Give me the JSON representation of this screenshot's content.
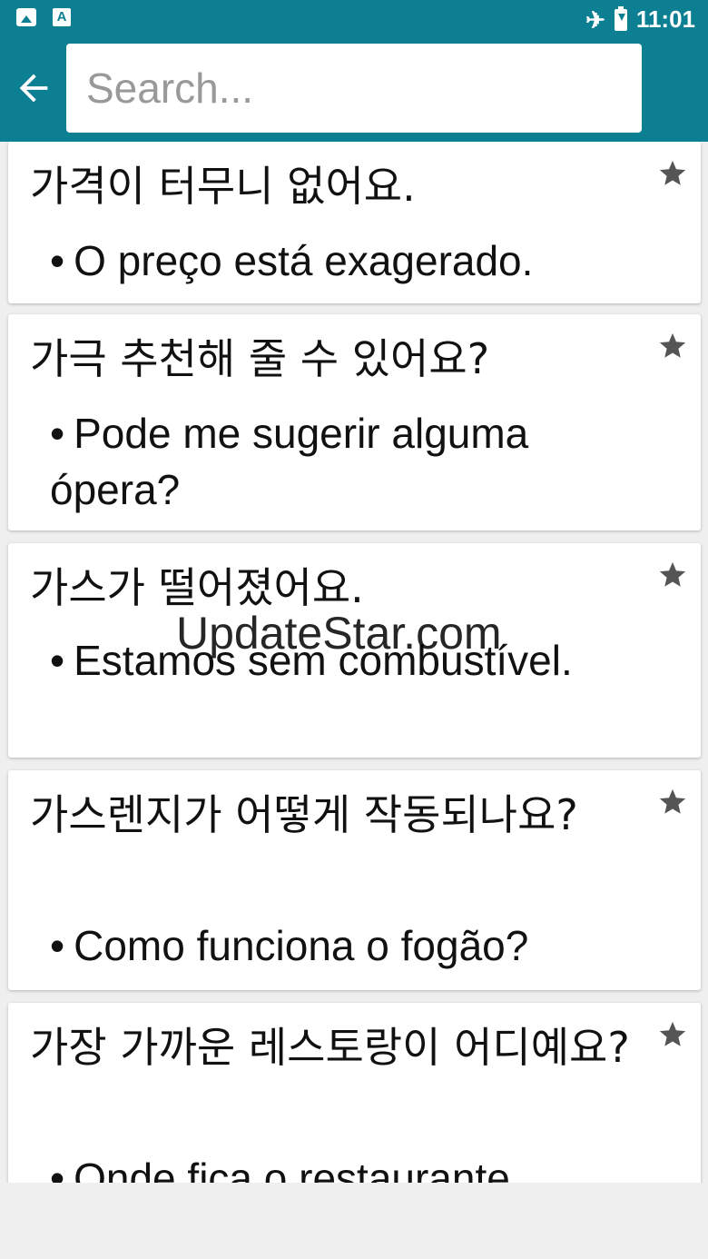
{
  "status_bar": {
    "time": "11:01",
    "left_icons": [
      "image-icon",
      "text-a-icon"
    ],
    "right_icons": [
      "airplane-mode-icon",
      "battery-charging-icon"
    ]
  },
  "app_bar": {
    "back_icon": "arrow-left-icon",
    "search": {
      "placeholder": "Search...",
      "value": ""
    },
    "colors": {
      "primary": "#0c7f92",
      "background": "#efefef"
    }
  },
  "phrases": [
    {
      "korean": "가격이 터무니 없어요.",
      "translation": "O preço está exagerado.",
      "star_icon": "star-icon"
    },
    {
      "korean": "가극 추천해 줄 수 있어요?",
      "translation": "Pode me sugerir alguma ópera?",
      "star_icon": "star-icon"
    },
    {
      "korean": "가스가 떨어졌어요.",
      "translation": "Estamos sem combustível.",
      "star_icon": "star-icon"
    },
    {
      "korean": "가스렌지가 어떻게 작동되나요?",
      "translation": "Como funciona o fogão?",
      "star_icon": "star-icon"
    },
    {
      "korean": "가장 가까운 레스토랑이 어디예요?",
      "translation": "Onde fica o restaurante",
      "star_icon": "star-icon"
    }
  ],
  "bullet": "•",
  "watermark": "UpdateStar.com"
}
